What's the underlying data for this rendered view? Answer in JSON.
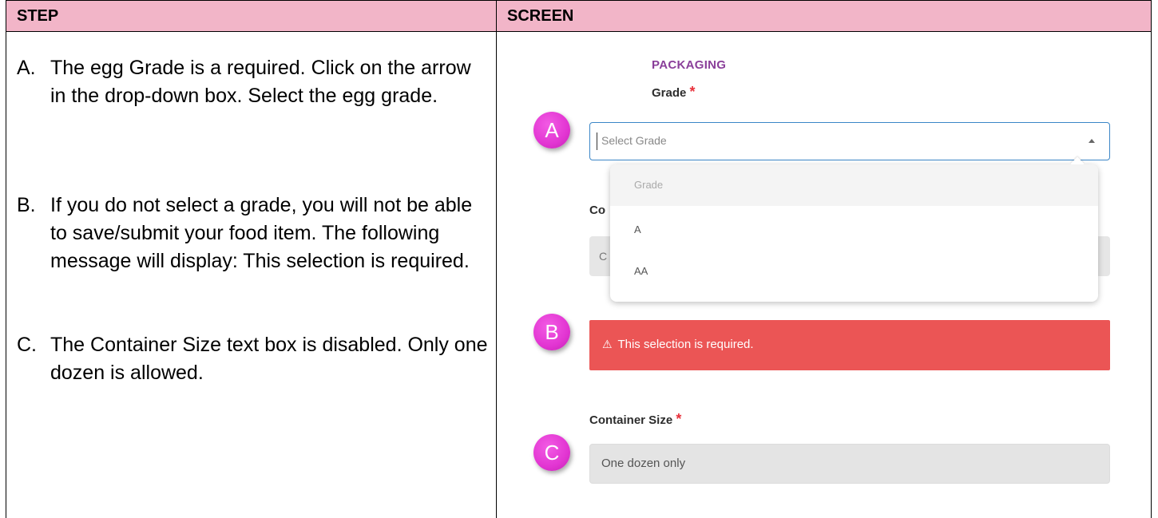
{
  "table": {
    "header_step": "STEP",
    "header_screen": "SCREEN"
  },
  "steps": [
    {
      "letter": "A.",
      "text": "The egg Grade is a required.  Click on the arrow in the drop-down box. Select the egg grade."
    },
    {
      "letter": "B.",
      "text": "If you do not select a grade, you will not be able to save/submit your food item. The following message will display: This selection is required."
    },
    {
      "letter": "C.",
      "text": "The Container Size text box is disabled. Only one dozen is allowed."
    }
  ],
  "screen": {
    "section_heading": "PACKAGING",
    "grade_label": "Grade",
    "required_mark": "*",
    "grade_placeholder": "Select Grade",
    "dropdown_options": [
      "Grade",
      "A",
      "AA"
    ],
    "hidden_label_fragment": "Co",
    "hidden_input_fragment": "C",
    "error_icon": "⚠",
    "error_message": "This selection is required.",
    "container_label": "Container Size",
    "container_value": "One dozen only",
    "badges": [
      "A",
      "B",
      "C"
    ]
  },
  "colors": {
    "header_bg": "#f2b5c8",
    "badge": "#e235d2",
    "error_bg": "#eb5555",
    "section_heading": "#8a3f9a",
    "focus_border": "#3b86c7",
    "required": "#e8303b"
  }
}
